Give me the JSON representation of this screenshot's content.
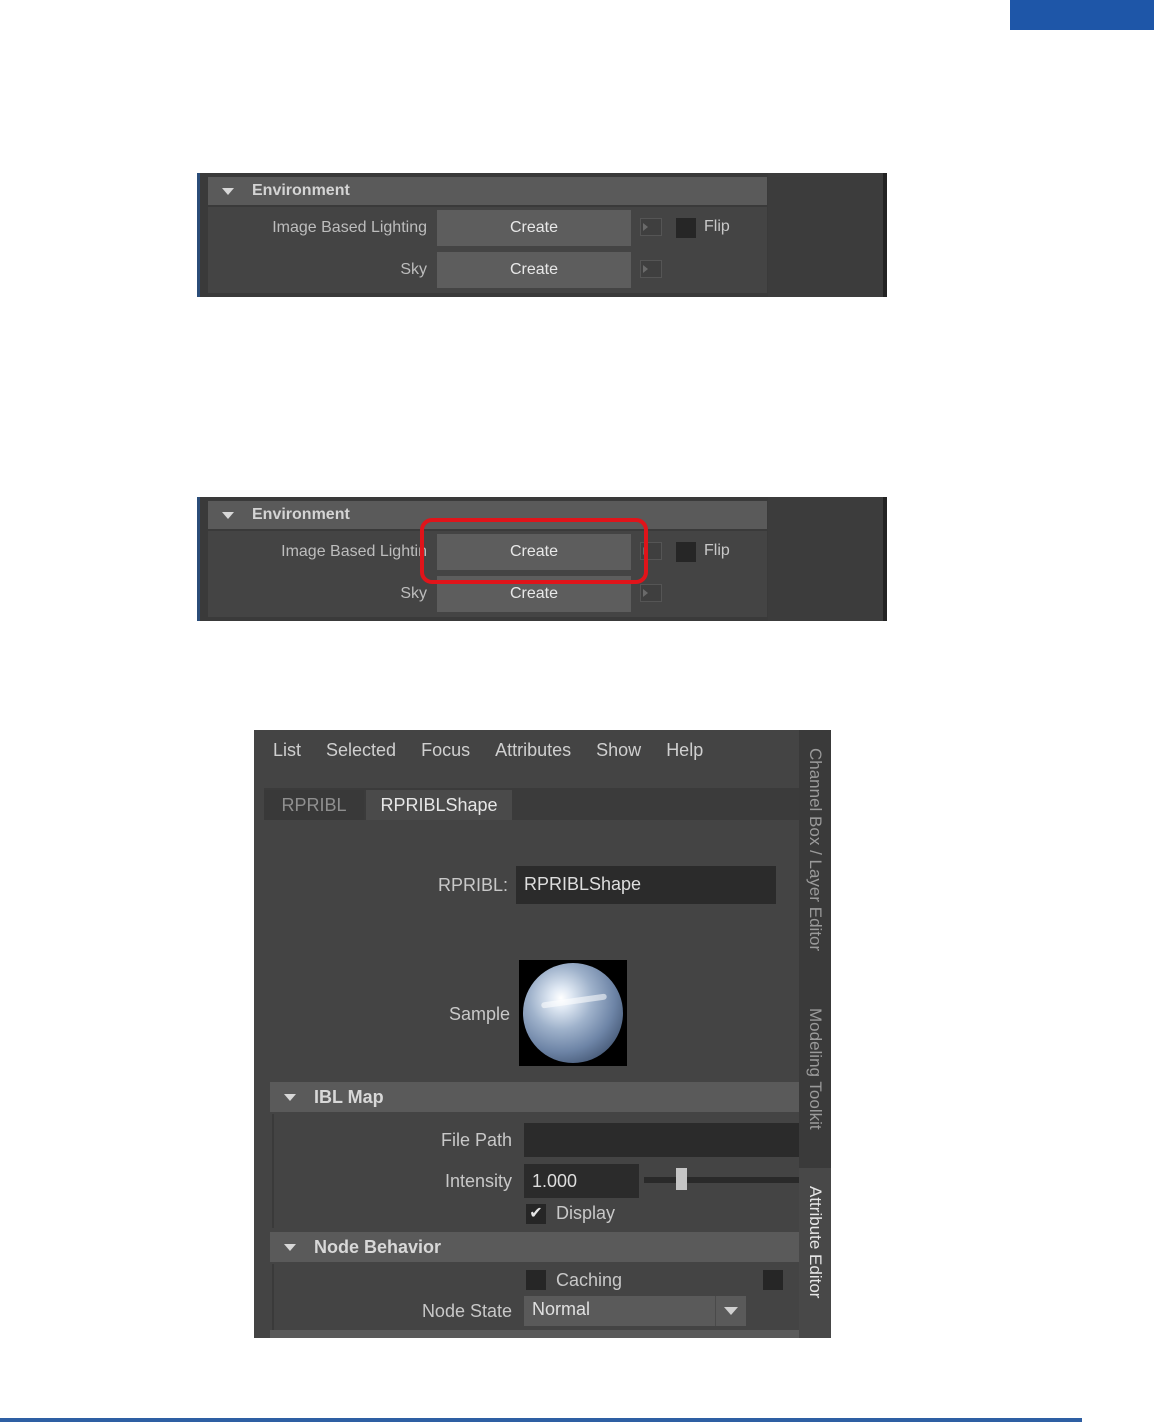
{
  "env_panels": [
    {
      "header": "Environment",
      "rows": [
        {
          "label": "Image Based Lighting",
          "button": "Create",
          "flip": "Flip"
        },
        {
          "label": "Sky",
          "button": "Create"
        }
      ]
    },
    {
      "header": "Environment",
      "rows": [
        {
          "label": "Image Based Lightin",
          "button": "Create",
          "flip": "Flip"
        },
        {
          "label": "Sky",
          "button": "Create"
        }
      ],
      "highlight_color": "#e0141a"
    }
  ],
  "attribute_editor": {
    "menu": [
      "List",
      "Selected",
      "Focus",
      "Attributes",
      "Show",
      "Help"
    ],
    "tabs": [
      "RPRIBL",
      "RPRIBLShape"
    ],
    "active_tab": "RPRIBLShape",
    "name_label": "RPRIBL:",
    "name_value": "RPRIBLShape",
    "sample_label": "Sample",
    "ibl_section": {
      "title": "IBL Map",
      "file_path_label": "File Path",
      "file_path_value": "",
      "intensity_label": "Intensity",
      "intensity_value": "1.000",
      "display_label": "Display",
      "display_checked": true
    },
    "node_behavior": {
      "title": "Node Behavior",
      "caching_label": "Caching",
      "node_state_label": "Node State",
      "node_state_value": "Normal"
    },
    "side_tabs": [
      "Channel Box / Layer Editor",
      "Modeling Toolkit",
      "Attribute Editor"
    ],
    "active_side_tab": "Attribute Editor"
  },
  "colors": {
    "accent_blue": "#1e56a8",
    "panel_bg": "#444444",
    "header_bg": "#5a5a5a"
  }
}
